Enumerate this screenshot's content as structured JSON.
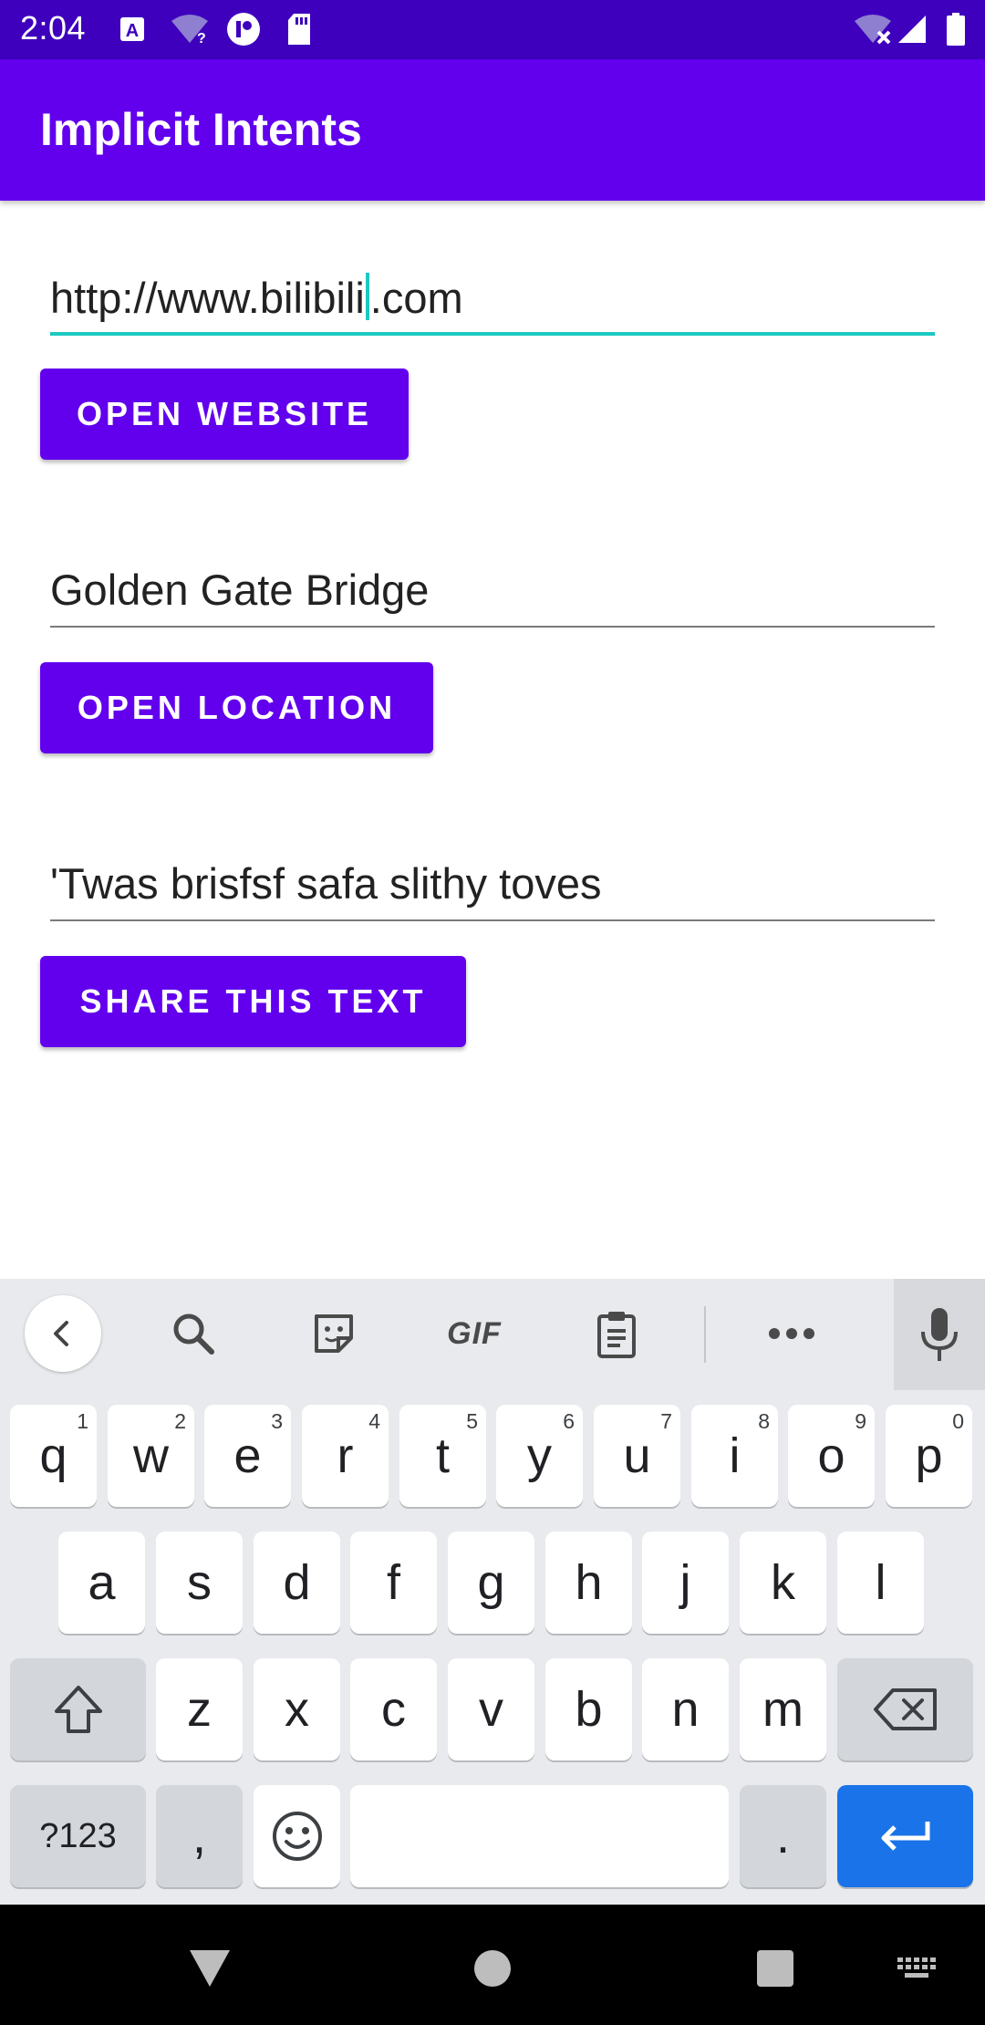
{
  "status_bar": {
    "time": "2:04"
  },
  "app_bar": {
    "title": "Implicit Intents"
  },
  "website": {
    "value_before_cursor": "http://www.bilibili",
    "value_after_cursor": ".com",
    "button_label": "OPEN WEBSITE"
  },
  "location": {
    "value": "Golden Gate Bridge",
    "button_label": "OPEN LOCATION"
  },
  "share": {
    "value": "'Twas brisfsf safa slithy toves",
    "button_label": "SHARE THIS TEXT"
  },
  "keyboard": {
    "toolbar": {
      "gif_label": "GIF"
    },
    "row1": [
      {
        "label": "q",
        "hint": "1"
      },
      {
        "label": "w",
        "hint": "2"
      },
      {
        "label": "e",
        "hint": "3"
      },
      {
        "label": "r",
        "hint": "4"
      },
      {
        "label": "t",
        "hint": "5"
      },
      {
        "label": "y",
        "hint": "6"
      },
      {
        "label": "u",
        "hint": "7"
      },
      {
        "label": "i",
        "hint": "8"
      },
      {
        "label": "o",
        "hint": "9"
      },
      {
        "label": "p",
        "hint": "0"
      }
    ],
    "row2": [
      "a",
      "s",
      "d",
      "f",
      "g",
      "h",
      "j",
      "k",
      "l"
    ],
    "row3": [
      "z",
      "x",
      "c",
      "v",
      "b",
      "n",
      "m"
    ],
    "symbols_label": "?123",
    "comma_label": ",",
    "period_label": "."
  },
  "colors": {
    "accent": "#6200ee",
    "status_bar": "#3e00bd",
    "focus": "#1cc9c1",
    "enter_key": "#1a73e8"
  }
}
